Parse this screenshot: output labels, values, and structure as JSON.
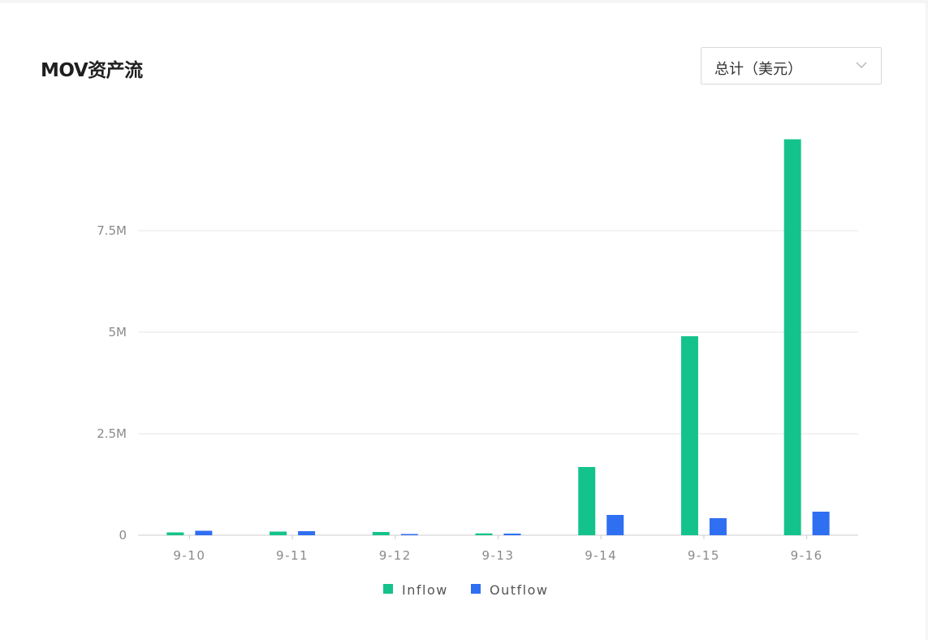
{
  "header": {
    "title": "MOV资产流",
    "select_value": "总计（美元）"
  },
  "chart_data": {
    "type": "bar",
    "categories": [
      "9-10",
      "9-11",
      "9-12",
      "9-13",
      "9-14",
      "9-15",
      "9-16"
    ],
    "series": [
      {
        "name": "Inflow",
        "color": "#14c38b",
        "values": [
          70000,
          90000,
          80000,
          45000,
          1680000,
          4900000,
          9750000
        ]
      },
      {
        "name": "Outflow",
        "color": "#2f6ff2",
        "values": [
          110000,
          100000,
          30000,
          40000,
          500000,
          420000,
          580000
        ]
      }
    ],
    "y_ticks": [
      {
        "value": 0,
        "label": "0"
      },
      {
        "value": 2500000,
        "label": "2.5M"
      },
      {
        "value": 5000000,
        "label": "5M"
      },
      {
        "value": 7500000,
        "label": "7.5M"
      }
    ],
    "ylim": [
      0,
      10000000
    ],
    "legend_position": "bottom-center",
    "grid": true
  }
}
